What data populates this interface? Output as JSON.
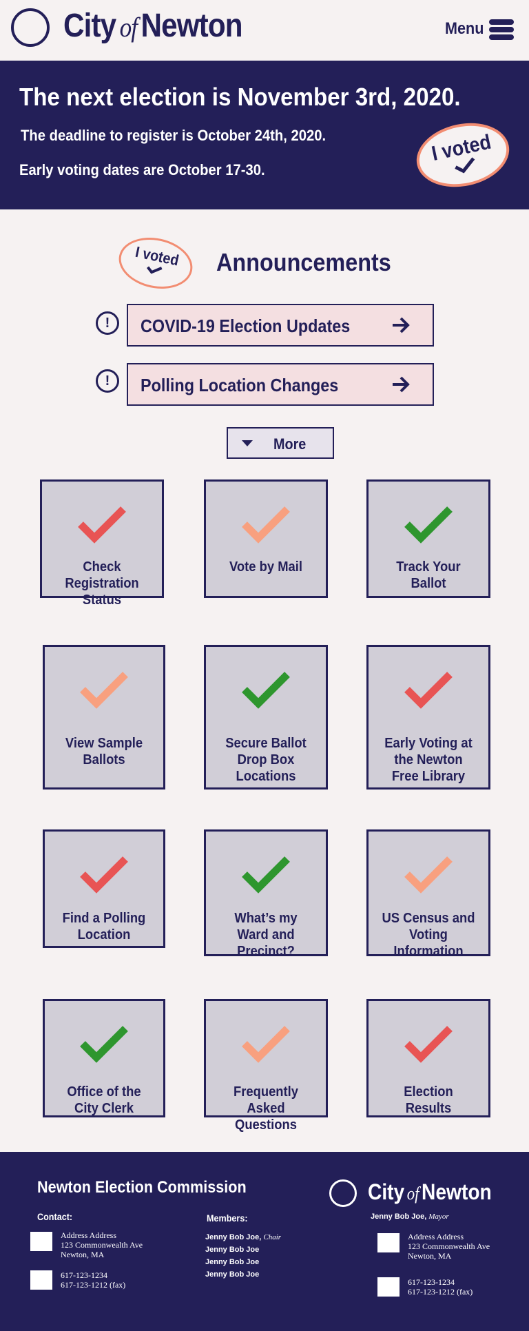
{
  "header": {
    "logo": {
      "city": "City",
      "of": "of",
      "name": "Newton"
    },
    "menu_label": "Menu"
  },
  "banner": {
    "headline": "The next election is November 3rd, 2020.",
    "deadline": "The deadline to register is October 24th, 2020.",
    "early_voting": "Early voting dates are October 17-30.",
    "sticker_text": "I voted"
  },
  "announcements": {
    "title": "Announcements",
    "sticker_text": "I voted",
    "items": [
      {
        "label": "COVID-19 Election Updates",
        "icon": "exclamation-icon"
      },
      {
        "label": "Polling Location Changes",
        "icon": "exclamation-icon"
      }
    ],
    "more_label": "More"
  },
  "tiles": [
    {
      "label": "Check Registration Status",
      "check_color": "#e85454"
    },
    {
      "label": "Vote by Mail",
      "check_color": "#f8a07f"
    },
    {
      "label": "Track Your Ballot",
      "check_color": "#2e962e"
    },
    {
      "label": "View Sample Ballots",
      "check_color": "#f8a07f"
    },
    {
      "label": "Secure Ballot Drop Box Locations",
      "check_color": "#2e962e"
    },
    {
      "label": "Early Voting at the Newton Free Library",
      "check_color": "#e85454"
    },
    {
      "label": "Find a Polling Location",
      "check_color": "#e85454"
    },
    {
      "label": "What’s my Ward and Precinct?",
      "check_color": "#2e962e"
    },
    {
      "label": "US Census and Voting Information",
      "check_color": "#f8a07f"
    },
    {
      "label": "Office of the City Clerk",
      "check_color": "#2e962e"
    },
    {
      "label": "Frequently Asked Questions",
      "check_color": "#f8a07f"
    },
    {
      "label": "Election Results",
      "check_color": "#e85454"
    }
  ],
  "footer": {
    "title": "Newton Election Commission",
    "contact_label": "Contact:",
    "contact_address": [
      "Address Address",
      "123 Commonwealth Ave",
      "Newton, MA"
    ],
    "contact_phones": [
      "617-123-1234",
      "617-123-1212 (fax)"
    ],
    "members_label": "Members:",
    "members": [
      {
        "name": "Jenny Bob Joe,",
        "role": "Chair"
      },
      {
        "name": "Jenny Bob Joe",
        "role": ""
      },
      {
        "name": "Jenny Bob Joe",
        "role": ""
      },
      {
        "name": "Jenny Bob Joe",
        "role": ""
      }
    ],
    "logo": {
      "city": "City",
      "of": "of",
      "name": "Newton"
    },
    "mayor": {
      "name": "Jenny Bob Joe,",
      "role": "Mayor"
    },
    "right_address": [
      "Address Address",
      "123 Commonwealth Ave",
      "Newton, MA"
    ],
    "right_phones": [
      "617-123-1234",
      "617-123-1212 (fax)"
    ]
  },
  "colors": {
    "navy": "#231f58",
    "red": "#e85454",
    "salmon": "#f8a07f",
    "green": "#2e962e",
    "pink": "#f4dfe1",
    "tile": "#d1ced7"
  }
}
